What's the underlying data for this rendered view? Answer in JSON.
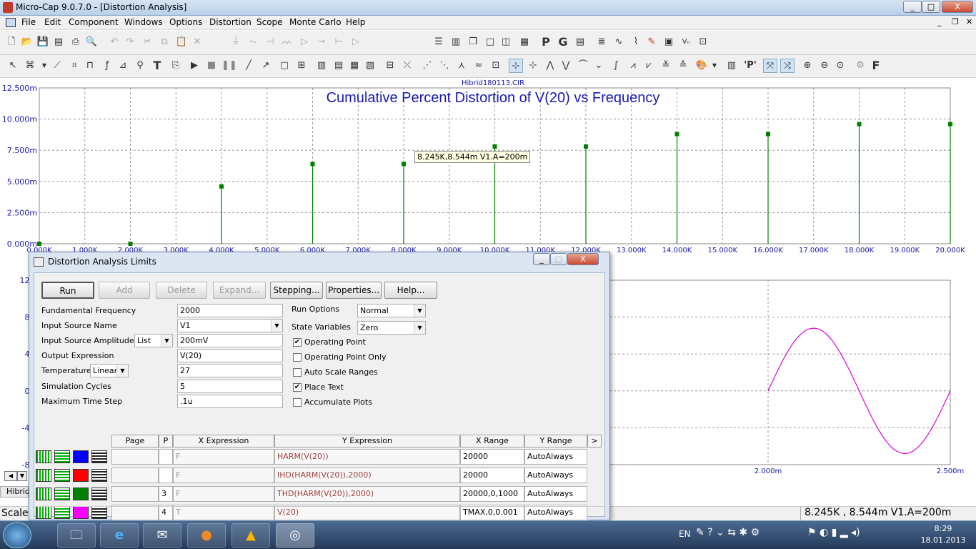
{
  "window": {
    "title": "Micro-Cap 9.0.7.0 - [Distortion Analysis]",
    "minimize": "_",
    "maximize": "□",
    "close": "X"
  },
  "menu": [
    "File",
    "Edit",
    "Component",
    "Windows",
    "Options",
    "Distortion",
    "Scope",
    "Monte Carlo",
    "Help"
  ],
  "plot": {
    "file_label": "Hibrid180113.CIR",
    "title": "Cumulative Percent Distortion of V(20) vs Frequency",
    "tooltip": "8.245K,8.544m V1.A=200m",
    "top_y_ticks": [
      "12.500m",
      "10.000m",
      "7.500m",
      "5.000m",
      "2.500m",
      "0.000m"
    ],
    "top_x_ticks": [
      "0.000K",
      "1.000K",
      "2.000K",
      "3.000K",
      "4.000K",
      "5.000K",
      "6.000K",
      "7.000K",
      "8.000K",
      "9.000K",
      "10.000K",
      "11.000K",
      "12.000K",
      "13.000K",
      "14.000K",
      "15.000K",
      "16.000K",
      "17.000K",
      "18.000K",
      "19.000K",
      "20.000K"
    ],
    "bottom_y_ticks": [
      "12.0",
      "8.0",
      "4.0",
      "0.0",
      "-4.0",
      "-8.0"
    ],
    "bottom_x_ticks": [
      "2.000m",
      "2.500m"
    ]
  },
  "chart_data": [
    {
      "type": "bar",
      "title": "Cumulative Percent Distortion of V(20) vs Frequency",
      "x": [
        0,
        2,
        4,
        6,
        8,
        10,
        12,
        14,
        16,
        18,
        20
      ],
      "xlabel": "",
      "ylabel": "",
      "values": [
        0,
        0,
        4.6,
        6.4,
        6.4,
        7.8,
        7.8,
        8.8,
        8.8,
        9.6,
        9.6
      ],
      "xlim": [
        0,
        20
      ],
      "ylim": [
        0,
        12.5
      ],
      "x_unit": "K",
      "y_unit": "m",
      "grid": true
    },
    {
      "type": "line",
      "x": [
        2.0,
        2.1,
        2.2,
        2.3,
        2.4,
        2.5
      ],
      "values": [
        0,
        6.8,
        0,
        -6.8,
        0,
        0
      ],
      "xlim": [
        2.0,
        2.5
      ],
      "ylim": [
        -8,
        12
      ],
      "grid": true
    }
  ],
  "dialog": {
    "title": "Distortion Analysis Limits",
    "buttons": {
      "run": "Run",
      "add": "Add",
      "delete": "Delete",
      "expand": "Expand...",
      "stepping": "Stepping...",
      "properties": "Properties...",
      "help": "Help..."
    },
    "fields": {
      "fund_freq_label": "Fundamental Frequency",
      "fund_freq": "2000",
      "input_source_label": "Input Source Name",
      "input_source": "V1",
      "amplitude_label": "Input Source Amplitude",
      "amplitude_mode": "List",
      "amplitude": "200mV",
      "output_expr_label": "Output Expression",
      "output_expr": "V(20)",
      "temperature_label": "Temperature",
      "temperature_mode": "Linear",
      "temperature": "27",
      "cycles_label": "Simulation Cycles",
      "cycles": "5",
      "max_step_label": "Maximum Time Step",
      "max_step": ".1u"
    },
    "options": {
      "run_options_label": "Run Options",
      "run_options": "Normal",
      "state_vars_label": "State Variables",
      "state_vars": "Zero",
      "operating_point": "Operating Point",
      "operating_point_only": "Operating Point Only",
      "auto_scale": "Auto Scale Ranges",
      "place_text": "Place Text",
      "accumulate": "Accumulate Plots"
    },
    "grid_headers": {
      "page": "Page",
      "p": "P",
      "x": "X Expression",
      "y": "Y Expression",
      "xrange": "X Range",
      "yrange": "Y Range",
      "more": ">"
    },
    "rows": [
      {
        "color": "#0000ff",
        "p": "",
        "x": "F",
        "y": "HARM(V(20))",
        "xrange": "20000",
        "yrange": "AutoAlways"
      },
      {
        "color": "#ff0000",
        "p": "",
        "x": "F",
        "y": "IHD(HARM(V(20)),2000)",
        "xrange": "20000",
        "yrange": "AutoAlways"
      },
      {
        "color": "#008000",
        "p": "3",
        "x": "F",
        "y": "THD(HARM(V(20)),2000)",
        "xrange": "20000,0,1000",
        "yrange": "AutoAlways"
      },
      {
        "color": "#ff00ff",
        "p": "4",
        "x": "T",
        "y": "V(20)",
        "xrange": "TMAX,0,0.001",
        "yrange": "AutoAlways"
      }
    ]
  },
  "status": {
    "left": "Scale",
    "right": "8.245K , 8.544m  V1.A=200m",
    "tab": "Hibrid"
  },
  "taskbar": {
    "lang": "EN",
    "time": "8:29",
    "date": "18.01.2013"
  }
}
